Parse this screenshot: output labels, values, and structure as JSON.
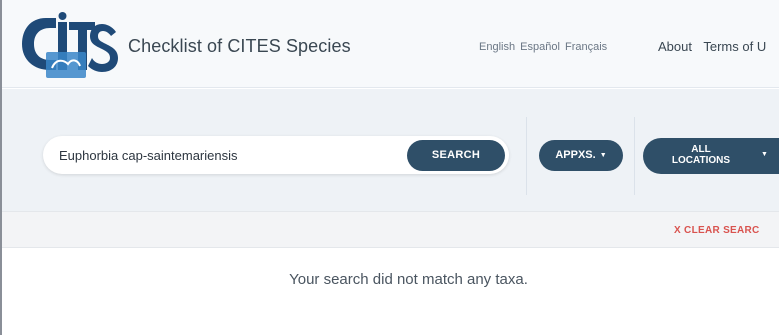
{
  "header": {
    "logo_text": "CITES",
    "title": "Checklist of CITES Species",
    "languages": [
      "English",
      "Español",
      "Français"
    ],
    "nav": [
      "About",
      "Terms of U"
    ]
  },
  "search": {
    "value": "Euphorbia cap-saintemariensis",
    "placeholder": "",
    "button_label": "SEARCH",
    "appendices_label": "APPXS.",
    "locations_label_line1": "ALL",
    "locations_label_line2": "LOCATIONS",
    "caret": "▼"
  },
  "clear": {
    "label": "X CLEAR SEARC"
  },
  "results": {
    "message": "Your search did not match any taxa."
  },
  "colors": {
    "accent": "#2f4f68",
    "clear": "#d9534f",
    "header_bg": "#f7f9fb",
    "search_band_bg": "#eef2f6"
  }
}
